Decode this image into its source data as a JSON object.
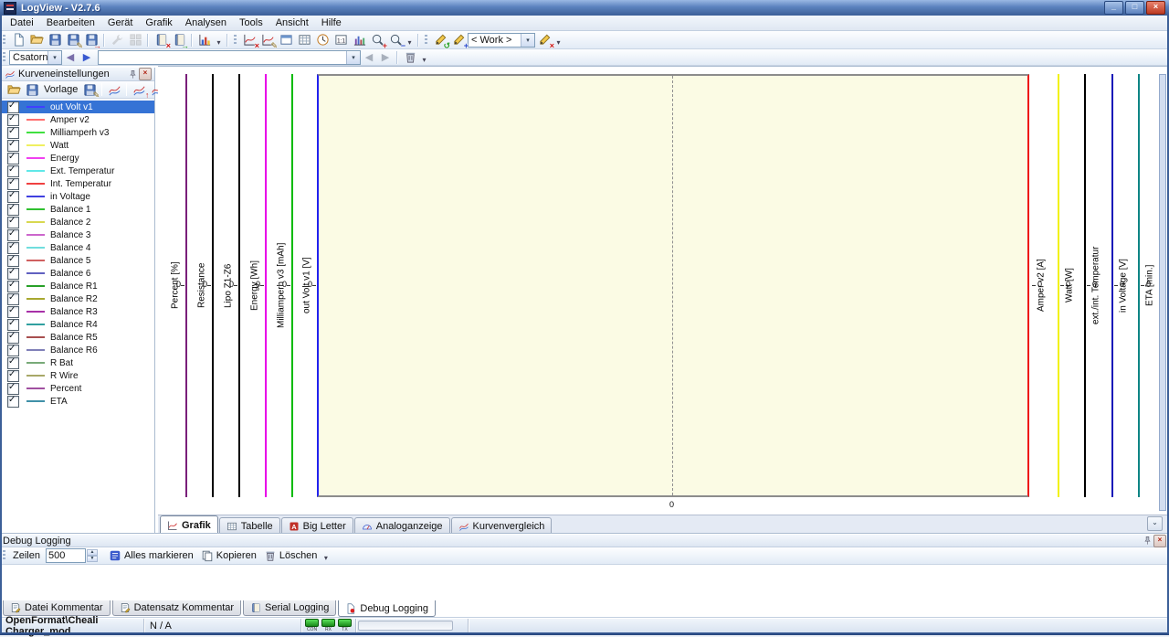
{
  "window": {
    "title": "LogView - V2.7.6",
    "controls": {
      "minimize": "_",
      "maximize": "□",
      "close": "×"
    }
  },
  "menu": {
    "items": [
      "Datei",
      "Bearbeiten",
      "Gerät",
      "Grafik",
      "Analysen",
      "Tools",
      "Ansicht",
      "Hilfe"
    ]
  },
  "toolbar_main": {
    "file_group": [
      {
        "name": "new-file-button",
        "sym": "page"
      },
      {
        "name": "open-file-button",
        "sym": "folder"
      },
      {
        "name": "save-button",
        "sym": "floppy"
      },
      {
        "name": "save-as-button",
        "sym": "floppy",
        "ovl": "✎",
        "ovl_color": "#8a6d1a"
      },
      {
        "name": "export-button",
        "sym": "floppy",
        "ovl": "→",
        "ovl_color": "#cc2222"
      }
    ],
    "device_group": [
      {
        "name": "device-config-button",
        "sym": "wrench",
        "disabled": true
      },
      {
        "name": "device-window-button",
        "sym": "grid",
        "disabled": true
      }
    ],
    "dataset_group": [
      {
        "name": "delete-dataset-button",
        "sym": "book",
        "ovl": "×",
        "ovl_color": "#cc1111"
      },
      {
        "name": "import-dataset-button",
        "sym": "book",
        "ovl": "→",
        "ovl_color": "#1a9a1a"
      }
    ],
    "export_group": [
      {
        "name": "export-chart-button",
        "sym": "chart"
      }
    ],
    "view_group": [
      {
        "name": "hide-curve-button",
        "sym": "curve",
        "ovl": "×",
        "ovl_color": "#cc1111"
      },
      {
        "name": "curve-cursor-button",
        "sym": "curve",
        "ovl": "✎",
        "ovl_color": "#8a6d1a"
      },
      {
        "name": "fit-window-button",
        "sym": "window"
      },
      {
        "name": "grid-toggle-button",
        "sym": "table"
      },
      {
        "name": "time-scale-button",
        "sym": "clock"
      },
      {
        "name": "zoom-one-to-one-button",
        "sym": "one"
      },
      {
        "name": "histogram-button",
        "sym": "hist"
      }
    ],
    "zoom_group": [
      {
        "name": "zoom-in-button",
        "sym": "zoom",
        "ovl": "+",
        "ovl_color": "#cc2222"
      },
      {
        "name": "zoom-out-button",
        "sym": "zoom",
        "ovl": "−",
        "ovl_color": "#2244cc"
      }
    ],
    "work_left_group": [
      {
        "name": "workspace-refresh-button",
        "sym": "pen",
        "ovl": "↺",
        "ovl_color": "#1a9a1a"
      },
      {
        "name": "workspace-add-button",
        "sym": "pen",
        "ovl": "+",
        "ovl_color": "#2244cc"
      }
    ],
    "work_selector_value": "< Work >",
    "work_right_group": [
      {
        "name": "workspace-delete-button",
        "sym": "pen",
        "ovl": "×",
        "ovl_color": "#cc1111"
      }
    ],
    "caret_glyph": "▾"
  },
  "toolbar_nav": {
    "channel_label": "Csatorna:",
    "channel_combo_value": "",
    "back_glyph": "◀",
    "forward_glyph": "▶",
    "clear_group": [
      {
        "name": "clear-log-button",
        "sym": "trash"
      }
    ]
  },
  "sidebar": {
    "title": "Kurveneinstellungen",
    "pin_icon": "pin",
    "close_glyph": "×",
    "tools_left": [
      {
        "name": "open-template-button",
        "sym": "folder"
      },
      {
        "name": "save-template-button",
        "sym": "floppy"
      }
    ],
    "template_label": "Vorlage",
    "tools_mid": [
      {
        "name": "save-template-as-button",
        "sym": "floppy",
        "ovl": "✎",
        "ovl_color": "#8a6d1a"
      }
    ],
    "tools_curves": [
      {
        "name": "curve-style-button",
        "sym": "compare"
      }
    ],
    "tools_smooth": [
      {
        "name": "curve-raise-button",
        "sym": "compare",
        "ovl": "↑",
        "ovl_color": "#cc2222"
      },
      {
        "name": "curve-lower-button",
        "sym": "compare",
        "ovl": "↓",
        "ovl_color": "#2244cc"
      }
    ],
    "curves": [
      {
        "label": "out Volt v1",
        "color": "#4040ff",
        "checked": true,
        "selected": true
      },
      {
        "label": "Amper v2",
        "color": "#ff7070",
        "checked": true
      },
      {
        "label": "Milliamperh v3",
        "color": "#40e040",
        "checked": true
      },
      {
        "label": "Watt",
        "color": "#f0f060",
        "checked": true
      },
      {
        "label": "Energy",
        "color": "#f040f0",
        "checked": true
      },
      {
        "label": "Ext. Temperatur",
        "color": "#60e8e8",
        "checked": true
      },
      {
        "label": "Int. Temperatur",
        "color": "#f04040",
        "checked": true
      },
      {
        "label": "in Voltage",
        "color": "#4040e0",
        "checked": true
      },
      {
        "label": "Balance 1",
        "color": "#30c030",
        "checked": true
      },
      {
        "label": "Balance 2",
        "color": "#d8d850",
        "checked": true
      },
      {
        "label": "Balance 3",
        "color": "#cc66cc",
        "checked": true
      },
      {
        "label": "Balance 4",
        "color": "#70dede",
        "checked": true
      },
      {
        "label": "Balance 5",
        "color": "#d06060",
        "checked": true
      },
      {
        "label": "Balance 6",
        "color": "#6060c0",
        "checked": true
      },
      {
        "label": "Balance R1",
        "color": "#28a028",
        "checked": true
      },
      {
        "label": "Balance R2",
        "color": "#a8a830",
        "checked": true
      },
      {
        "label": "Balance R3",
        "color": "#a830a8",
        "checked": true
      },
      {
        "label": "Balance R4",
        "color": "#30a0a0",
        "checked": true
      },
      {
        "label": "Balance R5",
        "color": "#a85050",
        "checked": true
      },
      {
        "label": "Balance R6",
        "color": "#8080b8",
        "checked": true
      },
      {
        "label": "R Bat",
        "color": "#78aa78",
        "checked": true
      },
      {
        "label": "R Wire",
        "color": "#a8a868",
        "checked": true
      },
      {
        "label": "Percent",
        "color": "#a050a0",
        "checked": true
      },
      {
        "label": "ETA",
        "color": "#4090a8",
        "checked": true
      }
    ]
  },
  "chart": {
    "plot_background": "#fbfbe4",
    "axes_left": [
      {
        "label": "Percent [%]",
        "color": "#7a1f7a",
        "tick": "0"
      },
      {
        "label": "Resistance",
        "color": "#000000",
        "tick": "0"
      },
      {
        "label": "Lipo Z1-Z6",
        "color": "#000000",
        "tick": "0"
      },
      {
        "label": "Energy [Wh]",
        "color": "#e800e8",
        "tick": "0"
      },
      {
        "label": "Milliamperh v3 [mAh]",
        "color": "#00bb00",
        "tick": "0"
      },
      {
        "label": "out Volt v1 [V]",
        "color": "#2222ee",
        "tick": "0",
        "border": true
      }
    ],
    "axes_right": [
      {
        "label": "Amper v2 [A]",
        "color": "#ee1111",
        "tick": "0",
        "border": true
      },
      {
        "label": "Watt [W]",
        "color": "#f2f20a",
        "tick": "0"
      },
      {
        "label": "ext./int. Temperatur",
        "color": "#000000",
        "tick": "0"
      },
      {
        "label": "in Voltage [V]",
        "color": "#1515b8",
        "tick": "0"
      },
      {
        "label": "ETA [min.]",
        "color": "#0e8585",
        "tick": "0"
      }
    ],
    "x_axis_tick": "0",
    "tabs": [
      {
        "label": "Grafik",
        "icon": "curve",
        "name": "tab-grafik",
        "active": true
      },
      {
        "label": "Tabelle",
        "icon": "table",
        "name": "tab-tabelle"
      },
      {
        "label": "Big Letter",
        "icon": "bigA",
        "name": "tab-big-letter"
      },
      {
        "label": "Analoganzeige",
        "icon": "gauge",
        "name": "tab-analoganzeige"
      },
      {
        "label": "Kurvenvergleich",
        "icon": "compare",
        "name": "tab-kurvenvergleich"
      }
    ],
    "tab_overflow_glyph": "⌄"
  },
  "debug_panel": {
    "title": "Debug Logging",
    "rows_label": "Zeilen",
    "rows_value": "500",
    "buttons": [
      {
        "name": "select-all-button",
        "sym": "bluesq",
        "label": "Alles markieren"
      },
      {
        "name": "copy-button",
        "sym": "copy",
        "label": "Kopieren"
      },
      {
        "name": "delete-button",
        "sym": "trash",
        "label": "Löschen"
      }
    ],
    "close_glyph": "×"
  },
  "bottom_tabs": [
    {
      "label": "Datei Kommentar",
      "icon": "note",
      "name": "tab-datei-kommentar"
    },
    {
      "label": "Datensatz Kommentar",
      "icon": "note",
      "name": "tab-datensatz-kommentar"
    },
    {
      "label": "Serial Logging",
      "icon": "book",
      "name": "tab-serial-logging"
    },
    {
      "label": "Debug Logging",
      "icon": "pagedot",
      "name": "tab-debug-logging",
      "active": true
    }
  ],
  "status_bar": {
    "file": "OpenFormat\\Cheali Charger_mod",
    "value": "N / A",
    "leds": [
      {
        "label": "CON"
      },
      {
        "label": "RX"
      },
      {
        "label": "TX"
      }
    ]
  }
}
